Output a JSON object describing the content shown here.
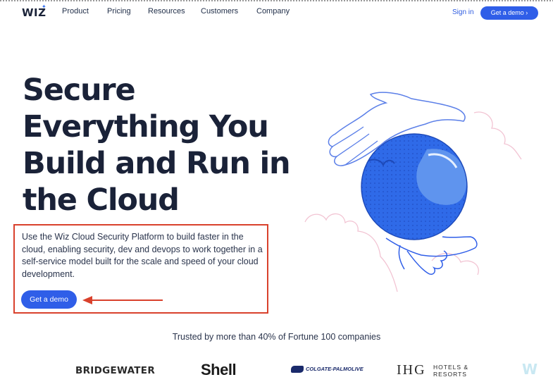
{
  "nav": {
    "logo": "WIZ",
    "links": [
      "Product",
      "Pricing",
      "Resources",
      "Customers",
      "Company"
    ],
    "signin": "Sign in",
    "demo_button": "Get a demo ›"
  },
  "hero": {
    "title_lines": [
      "Secure",
      "Everything You",
      "Build and Run in",
      "the Cloud"
    ],
    "description": "Use the Wiz Cloud Security Platform to build faster in the cloud, enabling security, dev and devops to work together in a self-service model built for the scale and speed of your cloud development.",
    "cta": "Get a demo"
  },
  "trusted": {
    "text": "Trusted by more than 40% of Fortune 100 companies",
    "logos": {
      "bridgewater": "BRIDGEWATER",
      "shell": "Shell",
      "colgate": "COLGATE-PALMOLIVE",
      "ihg": "IHG",
      "ihg_sub_1": "HOTELS &",
      "ihg_sub_2": "RESORTS",
      "faded": "W"
    }
  },
  "colors": {
    "brand_blue": "#2f5ee8",
    "heading": "#1a2238",
    "annotation_red": "#d9412c"
  },
  "icons": [
    "globe-illustration",
    "hand-illustration",
    "arrow-icon"
  ]
}
